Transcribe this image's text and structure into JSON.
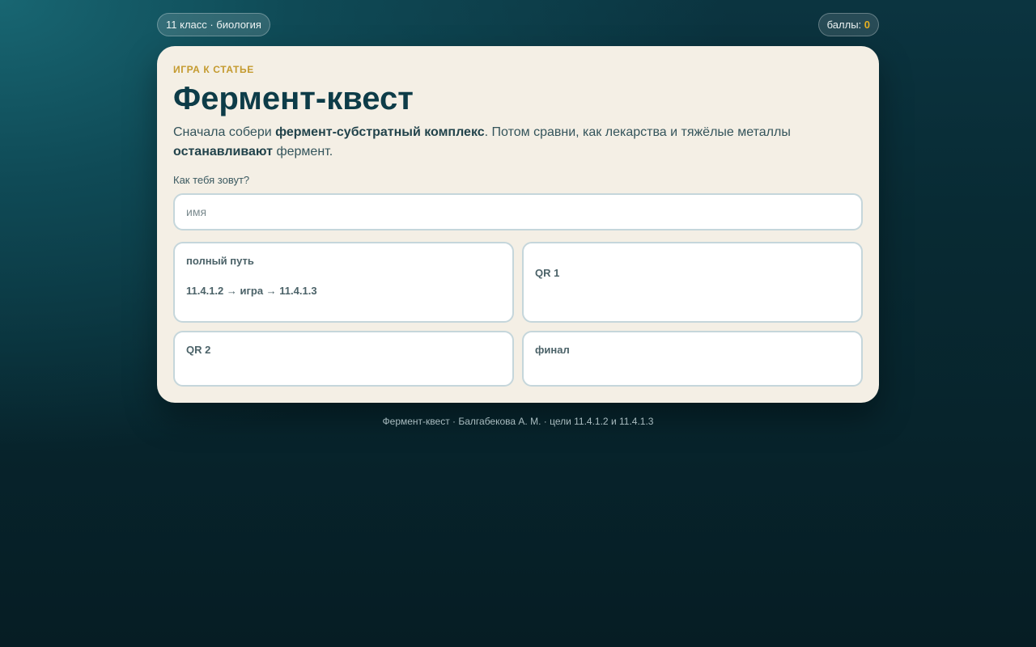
{
  "header": {
    "class_badge": "11 класс · биология",
    "score_label": "баллы: ",
    "score_value": "0"
  },
  "card": {
    "kicker": "ИГРА К СТАТЬЕ",
    "title": "Фермент-квест",
    "desc_part1": "Сначала собери ",
    "desc_bold1": "фермент-субстратный комплекс",
    "desc_part2": ". Потом сравни, как лекарства и тяжёлые металлы ",
    "desc_bold2": "останавливают",
    "desc_part3": " фермент.",
    "name_label": "Как тебя зовут?",
    "name_placeholder": "имя",
    "name_value": ""
  },
  "tiles": [
    {
      "label": "полный путь",
      "sub": "11.4.1.2 → игра → 11.4.1.3"
    },
    {
      "label": "QR 1"
    },
    {
      "label": "QR 2"
    },
    {
      "label": "финал"
    }
  ],
  "footer": {
    "text": "Фермент-квест · Балгабекова А. М. · цели 11.4.1.2 и 11.4.1.3"
  },
  "colors": {
    "accent_gold": "#e6b021",
    "kicker": "#c49a2e",
    "title": "#0d3c48",
    "card_bg": "#f4efe5"
  }
}
